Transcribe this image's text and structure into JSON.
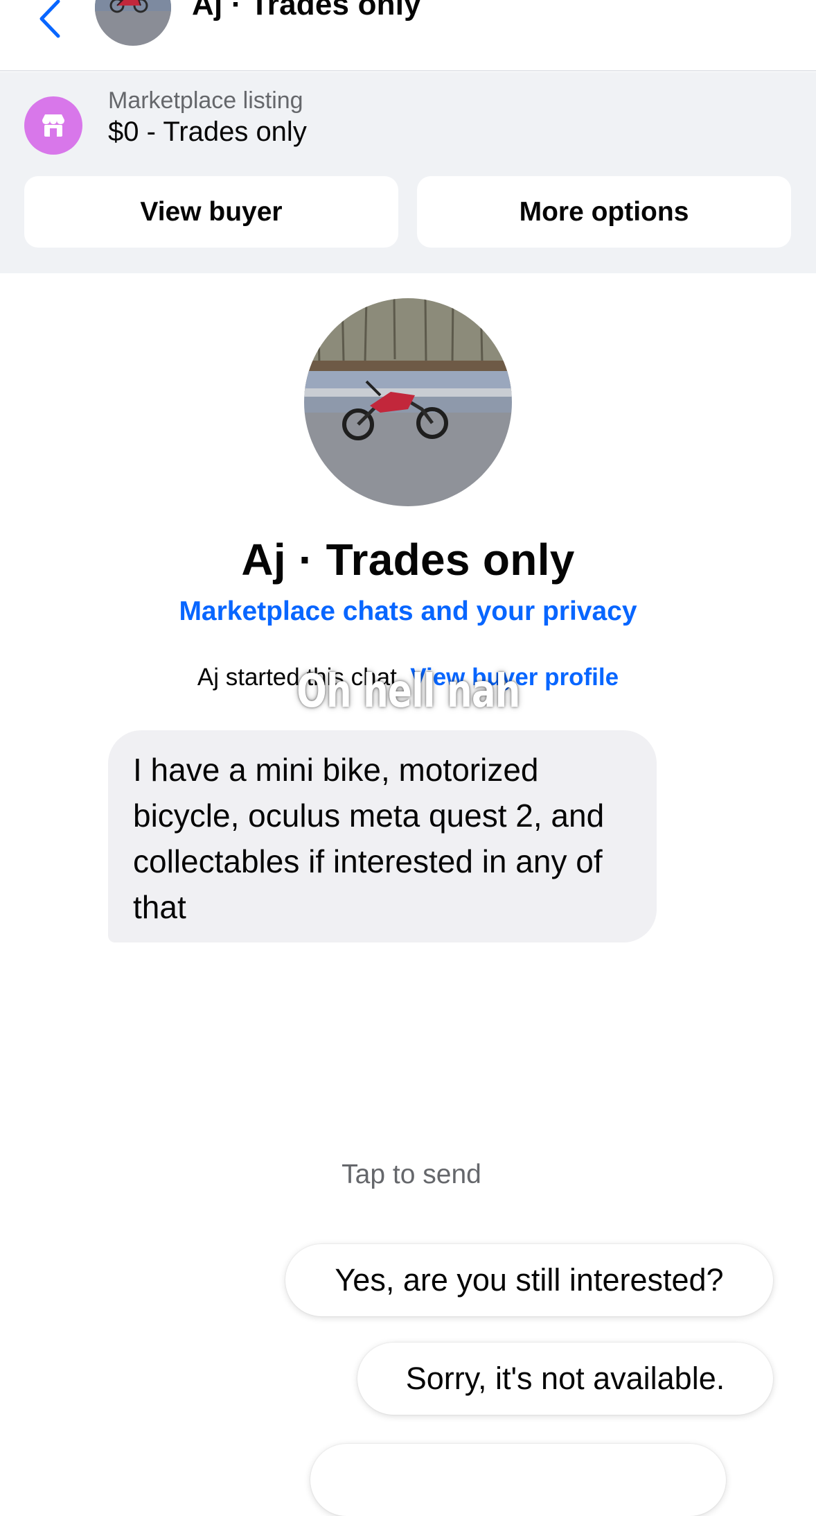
{
  "header": {
    "title": "Aj · Trades only",
    "back_icon": "chevron-left-icon",
    "accent_color": "#0866ff"
  },
  "listing": {
    "label": "Marketplace listing",
    "price_title": "$0 - Trades only",
    "icon": "marketplace-shop-icon",
    "icon_color": "#d877ea",
    "buttons": {
      "view_buyer": "View buyer",
      "more_options": "More options"
    }
  },
  "profile": {
    "name": "Aj · Trades only",
    "privacy_link": "Marketplace chats and your privacy",
    "started_text": "Aj started this chat.",
    "view_profile_link": "View buyer profile"
  },
  "overlay_caption": "Oh hell nah",
  "messages": [
    {
      "sender": "Aj",
      "text": "I have a mini bike, motorized bicycle, oculus meta quest 2, and collectables if interested in any of that"
    }
  ],
  "quick_replies": {
    "hint": "Tap to send",
    "options": [
      "Yes, are you still interested?",
      "Sorry, it's not available."
    ]
  }
}
